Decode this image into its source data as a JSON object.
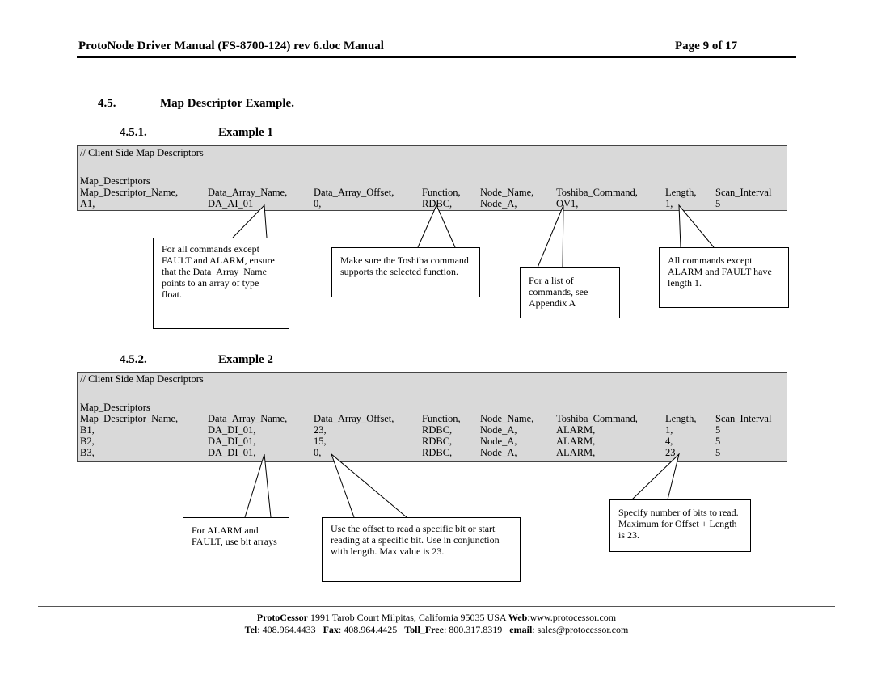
{
  "header": {
    "title": "ProtoNode Driver Manual (FS-8700-124) rev 6.doc Manual",
    "page": "Page 9 of 17"
  },
  "section": {
    "number": "4.5.",
    "title": "Map Descriptor Example."
  },
  "examples": [
    {
      "number": "4.5.1.",
      "title": "Example 1",
      "comment": "//   Client Side Map Descriptors",
      "block_label": "Map_Descriptors",
      "columns": [
        "Map_Descriptor_Name,",
        "Data_Array_Name,",
        "Data_Array_Offset,",
        "Function,",
        "Node_Name,",
        "Toshiba_Command,",
        "Length,",
        "Scan_Interval"
      ],
      "rows": [
        [
          "A1,",
          "DA_AI_01",
          "0,",
          "RDBC,",
          "Node_A,",
          "OV1,",
          "1,",
          "5"
        ]
      ],
      "callouts": [
        "For all commands except FAULT and ALARM, ensure that the Data_Array_Name points to an array of type float.",
        "Make sure the Toshiba command supports the selected function.",
        "For a list of commands, see Appendix A",
        "All commands except ALARM and FAULT have length 1."
      ]
    },
    {
      "number": "4.5.2.",
      "title": "Example 2",
      "comment": "//   Client Side Map Descriptors",
      "block_label": "Map_Descriptors",
      "columns": [
        "Map_Descriptor_Name,",
        "Data_Array_Name,",
        "Data_Array_Offset,",
        "Function,",
        "Node_Name,",
        "Toshiba_Command,",
        "Length,",
        "Scan_Interval"
      ],
      "rows": [
        [
          "B1,",
          "DA_DI_01,",
          "23,",
          "RDBC,",
          "Node_A,",
          "ALARM,",
          "1,",
          "5"
        ],
        [
          "B2,",
          "DA_DI_01,",
          "15,",
          "RDBC,",
          "Node_A,",
          "ALARM,",
          "4,",
          "5"
        ],
        [
          "B3,",
          "DA_DI_01,",
          "0,",
          "RDBC,",
          "Node_A,",
          "ALARM,",
          "23",
          "5"
        ]
      ],
      "callouts": [
        "For ALARM and FAULT, use bit arrays",
        "Use the offset to read a specific bit or start reading at a specific bit.  Use in conjunction with length.  Max value is 23.",
        "Specify number of bits to read.  Maximum for Offset + Length is 23."
      ]
    }
  ],
  "footer": {
    "company": "ProtoCessor",
    "address": " 1991 Tarob Court Milpitas, California 95035 USA  ",
    "web_label": "Web",
    "web": ":www.protocessor.com",
    "tel_label": "Tel",
    "tel": ": 408.964.4433   ",
    "fax_label": "Fax",
    "fax": ": 408.964.4425   ",
    "tollfree_label": "Toll_Free",
    "tollfree": ": 800.317.8319   ",
    "email_label": "email",
    "email": ": sales@protocessor.com"
  }
}
